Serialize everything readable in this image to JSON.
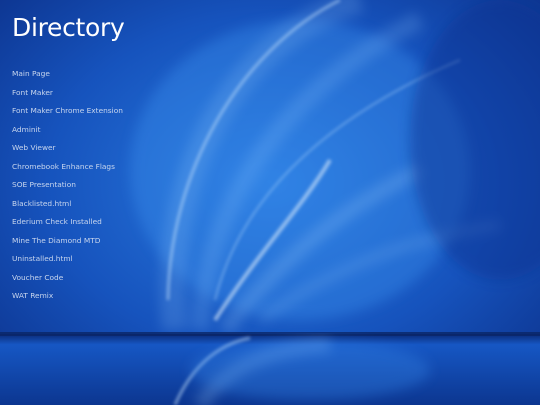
{
  "page": {
    "title": "Directory"
  },
  "links": [
    {
      "label": "Main Page"
    },
    {
      "label": "Font Maker"
    },
    {
      "label": "Font Maker Chrome Extension"
    },
    {
      "label": "Adminit"
    },
    {
      "label": "Web Viewer"
    },
    {
      "label": "Chromebook Enhance Flags"
    },
    {
      "label": "SOE Presentation"
    },
    {
      "label": "Blacklisted.html"
    },
    {
      "label": "Ederium Check Installed"
    },
    {
      "label": "Mine The Diamond MTD"
    },
    {
      "label": "Uninstalled.html"
    },
    {
      "label": "Voucher Code"
    },
    {
      "label": "WAT Remix"
    }
  ],
  "colors": {
    "background_base": "#1550b8",
    "background_deep": "#0a2f85",
    "text_title": "#ffffff",
    "text_link": "#c8d6ee"
  }
}
